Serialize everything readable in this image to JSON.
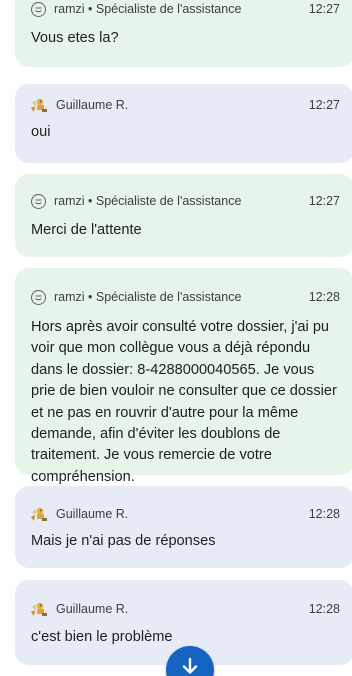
{
  "colors": {
    "agent_bubble": "#e6f4ea",
    "user_bubble": "#e7ebf6",
    "fab": "#1565c0"
  },
  "messages": [
    {
      "role": "agent",
      "sender": "ramzi • Spécialiste de l'assistance",
      "time": "12:27",
      "text": "Vous etes la?"
    },
    {
      "role": "user",
      "sender": "Guillaume R.",
      "time": "12:27",
      "text": "oui"
    },
    {
      "role": "agent",
      "sender": "ramzi • Spécialiste de l'assistance",
      "time": "12:27",
      "text": "Merci de l'attente"
    },
    {
      "role": "agent",
      "sender": "ramzi • Spécialiste de l'assistance",
      "time": "12:28",
      "text": "Hors après avoir consulté votre dossier, j'ai pu voir que mon collègue vous a déjà répondu dans le dossier: 8-4288000040565. Je vous prie de bien vouloir ne consulter que ce dossier et ne pas en rouvrir d'autre pour la même demande, afin d'éviter les doublons de traitement. Je vous remercie de votre compréhension."
    },
    {
      "role": "user",
      "sender": "Guillaume R.",
      "time": "12:28",
      "text": "Mais je n'ai pas de réponses"
    },
    {
      "role": "user",
      "sender": "Guillaume R.",
      "time": "12:28",
      "text": "c'est bien le problème"
    }
  ],
  "scroll_button": {
    "icon": "arrow-down-icon"
  }
}
